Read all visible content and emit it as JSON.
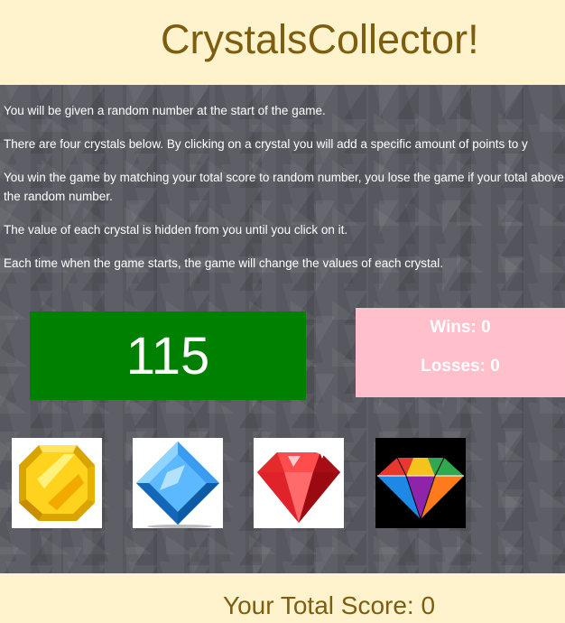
{
  "header": {
    "title": "CrystalsCollector!"
  },
  "instructions": [
    "You will be given a random number at the start of the game.",
    "There are four crystals below. By clicking on a crystal you will add a specific amount of points to y",
    "You win the game by matching your total score to random number, you lose the game if your total above the random number.",
    "The value of each crystal is hidden from you until you click on it.",
    "Each time when the game starts, the game will change the values of each crystal."
  ],
  "target_number": "115",
  "stats": {
    "wins": "Wins: 0",
    "losses": "Losses: 0"
  },
  "crystals": [
    {
      "icon": "yellow-crystal-icon"
    },
    {
      "icon": "blue-crystal-icon"
    },
    {
      "icon": "red-crystal-icon"
    },
    {
      "icon": "rainbow-crystal-icon"
    }
  ],
  "colors": {
    "header_bg": "#fff3cd",
    "title": "#7d5d10",
    "target_bg": "#008000",
    "stats_bg": "#ffc0cb"
  },
  "score": {
    "label": "Your Total Score: 0"
  }
}
